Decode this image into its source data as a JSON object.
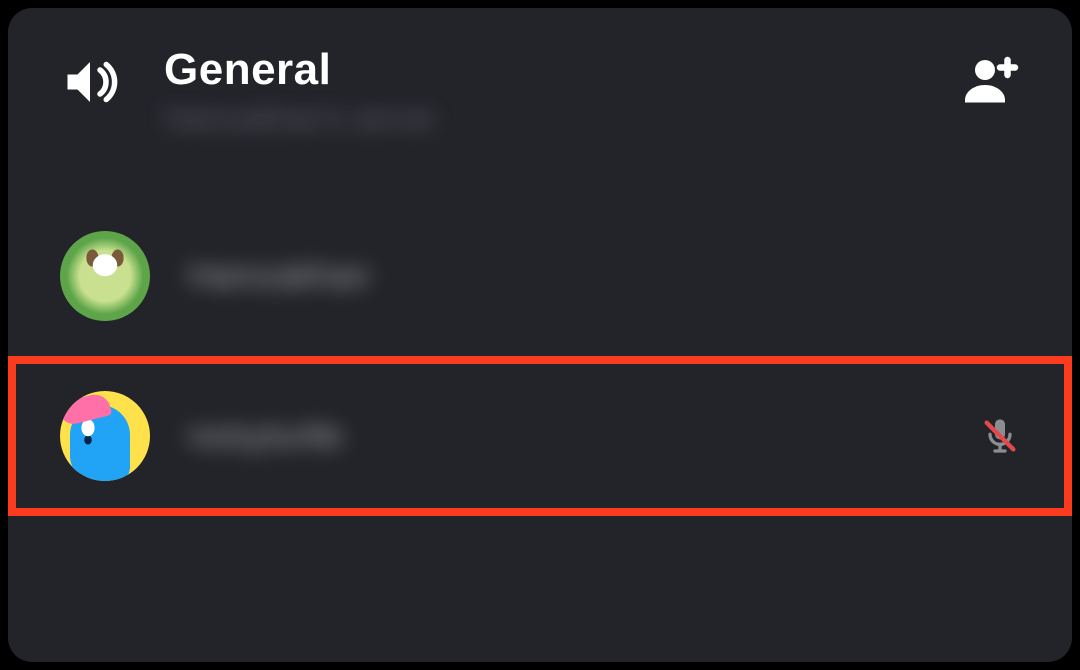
{
  "header": {
    "title": "General",
    "subtitle": "Hamzakhan's server"
  },
  "icons": {
    "speaker": "speaker-icon",
    "add_user": "add-user-icon",
    "mic_muted": "mic-muted-icon"
  },
  "users": [
    {
      "name": "Hamzakhan",
      "avatar_style": "dog",
      "muted": false,
      "highlighted": false
    },
    {
      "name": "noisyturtle",
      "avatar_style": "blue-monster",
      "muted": true,
      "highlighted": true
    }
  ],
  "colors": {
    "highlight_outline": "#fb3b1e",
    "panel_bg": "#23242a"
  }
}
